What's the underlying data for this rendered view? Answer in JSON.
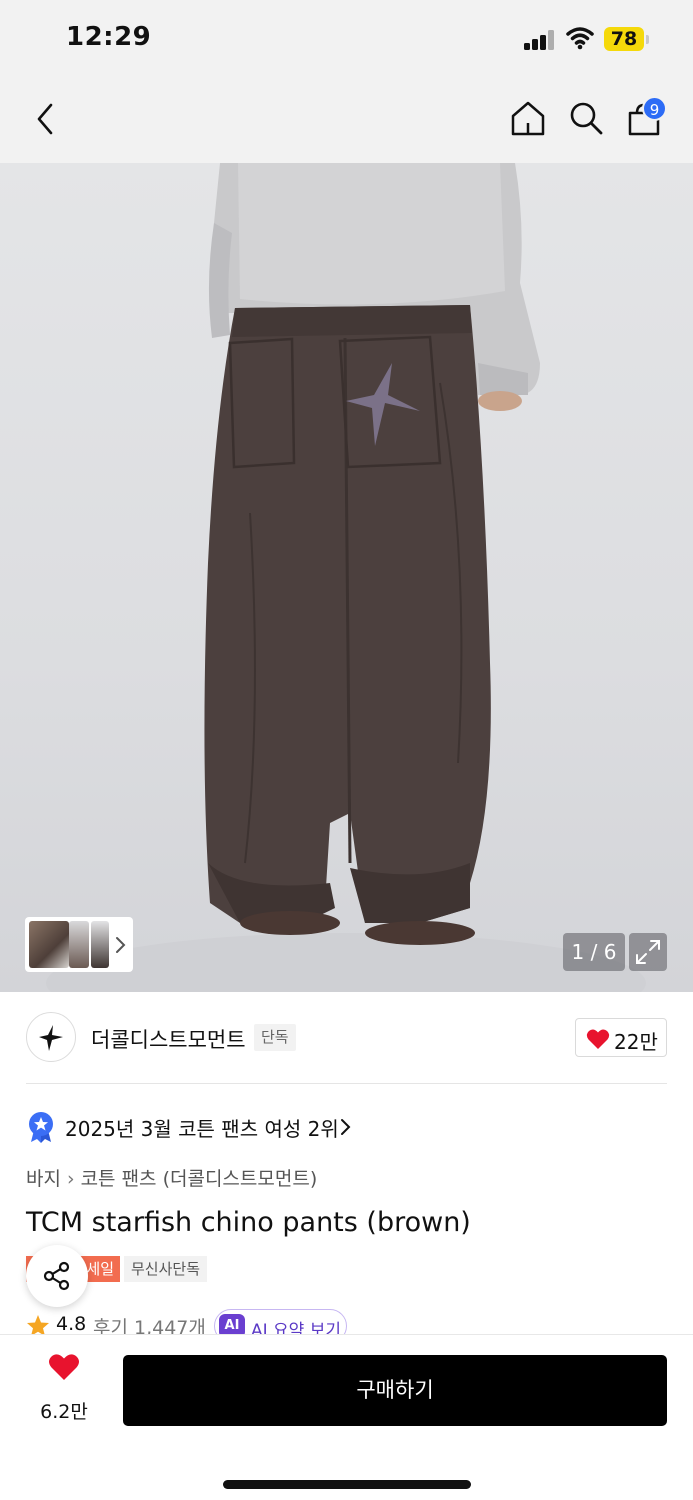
{
  "status_bar": {
    "time": "12:29",
    "battery": "78",
    "icons": [
      "cellular-signal-icon",
      "wifi-icon",
      "battery-icon"
    ]
  },
  "nav": {
    "icons": [
      "back-chevron-icon",
      "home-icon",
      "search-icon",
      "shopping-bag-icon"
    ],
    "cart_count": "9"
  },
  "gallery": {
    "counter": "1 / 6",
    "icons": [
      "expand-icon",
      "chevron-right-icon"
    ]
  },
  "brand": {
    "name": "더콜디스트모먼트",
    "tag": "단독",
    "likes": "22만",
    "logo_icon": "starfish-logo-icon",
    "heart_color": "#e8132e"
  },
  "ranking": {
    "text": "2025년 3월 코튼 팬츠 여성 2위",
    "icon": "ranking-medal-icon"
  },
  "breadcrumb": {
    "category": "바지",
    "subcategory": "코튼 팬츠 (더콜디스트모먼트)"
  },
  "product": {
    "title": "TCM starfish chino pants (brown)",
    "badge_sale": "세일",
    "badge_exclusive": "무신사단독",
    "sale_color": "#f26c4f"
  },
  "rating": {
    "score": "4.8",
    "reviews": "후기 1,447개",
    "ai_badge": "AI",
    "ai_label": "AI 요약 보기",
    "star_color": "#f5a623"
  },
  "bottom_bar": {
    "wishlist_count": "6.2만",
    "buy_label": "구매하기"
  }
}
